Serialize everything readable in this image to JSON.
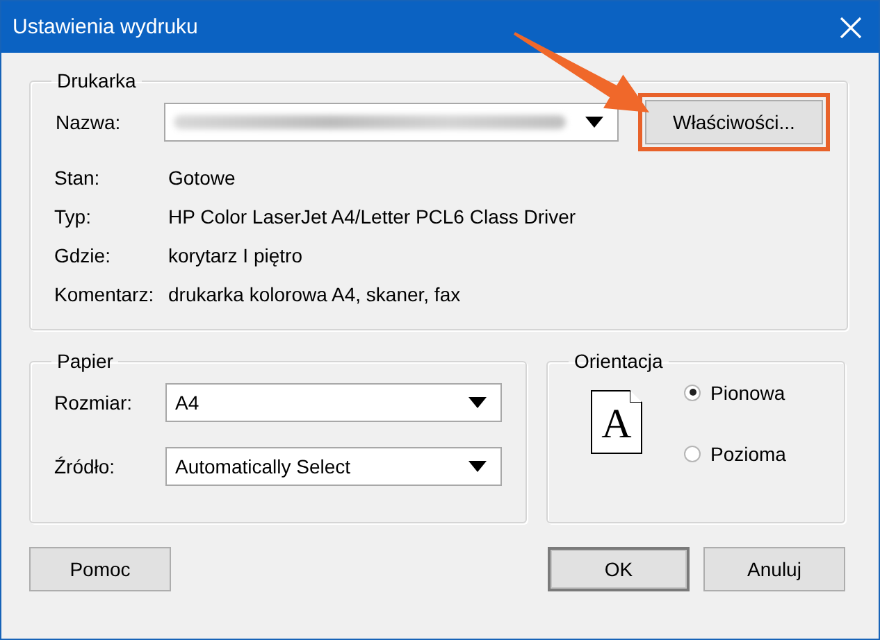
{
  "window": {
    "title": "Ustawienia wydruku"
  },
  "printer": {
    "legend": "Drukarka",
    "name_label": "Nazwa:",
    "name_blurred": true,
    "properties_button": {
      "label": "Właściwości...",
      "highlighted": true
    },
    "info": [
      {
        "label": "Stan:",
        "value": "Gotowe"
      },
      {
        "label": "Typ:",
        "value": "HP Color LaserJet A4/Letter PCL6 Class Driver"
      },
      {
        "label": "Gdzie:",
        "value": "korytarz I piętro"
      },
      {
        "label": "Komentarz:",
        "value": "drukarka kolorowa A4, skaner, fax"
      }
    ]
  },
  "paper": {
    "legend": "Papier",
    "fields": [
      {
        "label": "Rozmiar:",
        "value": "A4"
      },
      {
        "label": "Źródło:",
        "value": "Automatically Select"
      }
    ]
  },
  "orientation": {
    "legend": "Orientacja",
    "preview_letter": "A",
    "options": [
      {
        "label": "Pionowa",
        "selected": true
      },
      {
        "label": "Pozioma",
        "selected": false
      }
    ]
  },
  "buttons": [
    {
      "label": "Pomoc",
      "default": false
    },
    {
      "label": "OK",
      "default": true
    },
    {
      "label": "Anuluj",
      "default": false
    }
  ]
}
